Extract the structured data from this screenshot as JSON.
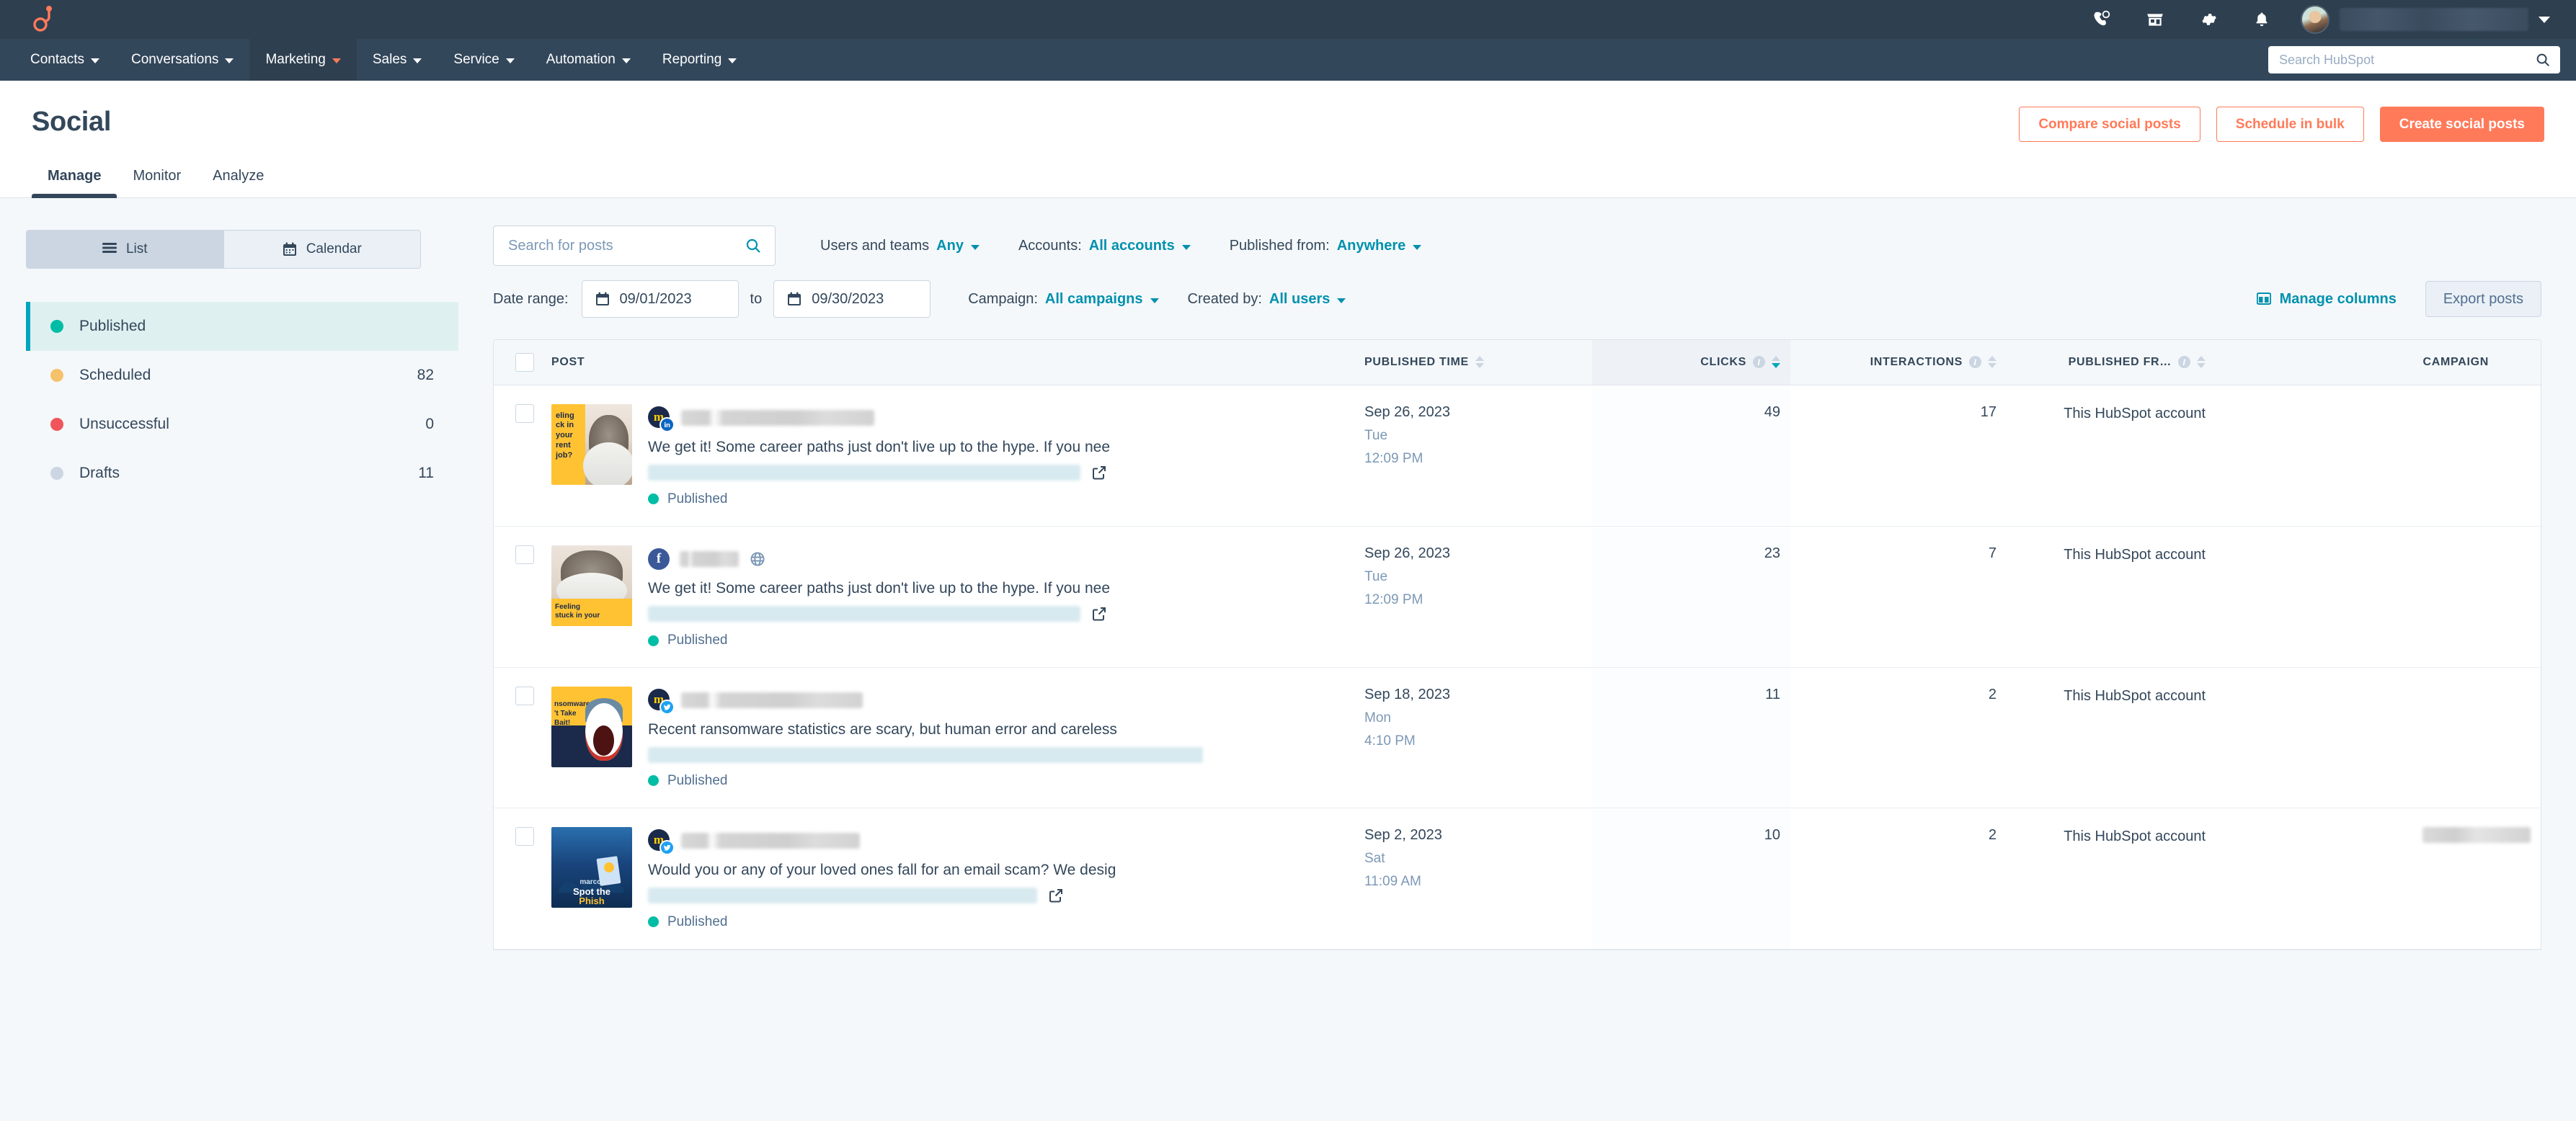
{
  "topbar": {
    "logo_name": "hubspot-sprocket-logo",
    "icons": [
      "phone-icon",
      "marketplace-icon",
      "gear-icon",
      "bell-icon"
    ],
    "account_name_redacted": "",
    "chevron": "chevron-down-icon"
  },
  "mainnav": {
    "items": [
      {
        "label": "Contacts",
        "active": false
      },
      {
        "label": "Conversations",
        "active": false
      },
      {
        "label": "Marketing",
        "active": true
      },
      {
        "label": "Sales",
        "active": false
      },
      {
        "label": "Service",
        "active": false
      },
      {
        "label": "Automation",
        "active": false
      },
      {
        "label": "Reporting",
        "active": false
      }
    ],
    "search_placeholder": "Search HubSpot"
  },
  "page": {
    "title": "Social",
    "actions": {
      "compare": "Compare social posts",
      "schedule": "Schedule in bulk",
      "create": "Create social posts"
    },
    "tabs": [
      {
        "label": "Manage",
        "active": true
      },
      {
        "label": "Monitor",
        "active": false
      },
      {
        "label": "Analyze",
        "active": false
      }
    ]
  },
  "sidebar": {
    "view_toggle": [
      {
        "label": "List",
        "icon": "list-icon",
        "active": true
      },
      {
        "label": "Calendar",
        "icon": "calendar-icon",
        "active": false
      }
    ],
    "statuses": [
      {
        "label": "Published",
        "count": "",
        "color": "#00bda5",
        "active": true
      },
      {
        "label": "Scheduled",
        "count": "82",
        "color": "#f5c26b",
        "active": false
      },
      {
        "label": "Unsuccessful",
        "count": "0",
        "color": "#f2545b",
        "active": false
      },
      {
        "label": "Drafts",
        "count": "11",
        "color": "#cbd6e2",
        "active": false
      }
    ]
  },
  "filters": {
    "search_placeholder": "Search for posts",
    "users_and_teams": {
      "label": "Users and teams",
      "value": "Any"
    },
    "accounts": {
      "label": "Accounts:",
      "value": "All accounts"
    },
    "published_from": {
      "label": "Published from:",
      "value": "Anywhere"
    },
    "date_range": {
      "label": "Date range:",
      "from": "09/01/2023",
      "to_word": "to",
      "to": "09/30/2023"
    },
    "campaign": {
      "label": "Campaign:",
      "value": "All campaigns"
    },
    "created_by": {
      "label": "Created by:",
      "value": "All users"
    },
    "manage_columns": "Manage columns",
    "export_posts": "Export posts"
  },
  "table": {
    "columns": [
      {
        "key": "post",
        "label": "POST",
        "info": false,
        "sort": "none"
      },
      {
        "key": "published_time",
        "label": "PUBLISHED TIME",
        "info": false,
        "sort": "none"
      },
      {
        "key": "clicks",
        "label": "CLICKS",
        "info": true,
        "sort": "desc"
      },
      {
        "key": "interactions",
        "label": "INTERACTIONS",
        "info": true,
        "sort": "none"
      },
      {
        "key": "published_from",
        "label": "PUBLISHED FR…",
        "info": true,
        "sort": "none"
      },
      {
        "key": "campaign",
        "label": "CAMPAIGN",
        "info": false,
        "sort": "none"
      }
    ],
    "rows": [
      {
        "network": "linkedin",
        "thumb": "cat-cone-yellow",
        "text": "We get it! Some career paths just don't live up to the hype. If you nee",
        "status": "Published",
        "published_date": "Sep 26, 2023",
        "published_day": "Tue",
        "published_time": "12:09 PM",
        "clicks": "49",
        "interactions": "17",
        "published_from": "This HubSpot account",
        "campaign": "",
        "campaign_redacted": false
      },
      {
        "network": "facebook",
        "thumb": "cat-cone-white",
        "text": "We get it! Some career paths just don't live up to the hype. If you nee",
        "status": "Published",
        "published_date": "Sep 26, 2023",
        "published_day": "Tue",
        "published_time": "12:09 PM",
        "clicks": "23",
        "interactions": "7",
        "published_from": "This HubSpot account",
        "campaign": "",
        "campaign_redacted": false
      },
      {
        "network": "twitter",
        "thumb": "shark-ransomware",
        "text": "Recent ransomware statistics are scary, but human error and careless",
        "status": "Published",
        "published_date": "Sep 18, 2023",
        "published_day": "Mon",
        "published_time": "4:10 PM",
        "clicks": "11",
        "interactions": "2",
        "published_from": "This HubSpot account",
        "campaign": "",
        "campaign_redacted": false
      },
      {
        "network": "twitter",
        "thumb": "spot-the-phish",
        "text": "Would you or any of your loved ones fall for an email scam? We desig",
        "status": "Published",
        "published_date": "Sep 2, 2023",
        "published_day": "Sat",
        "published_time": "11:09 AM",
        "clicks": "10",
        "interactions": "2",
        "published_from": "This HubSpot account",
        "campaign": "",
        "campaign_redacted": true
      }
    ],
    "thumb_text": {
      "cat_cone_yellow": "eling\nck in your\nrent job?",
      "cat_cone_white": "Feeling\nstuck in your",
      "shark": "nsomware:\n't Take\nBait!",
      "phish_logo": "marco)",
      "phish_line1": "Spot the",
      "phish_line2": "Phish"
    }
  },
  "colors": {
    "brand_orange": "#ff7a59",
    "nav_dark": "#33475b",
    "nav_darker": "#2e3f50",
    "teal": "#00a4bd",
    "link_teal": "#0091ae",
    "published_green": "#00bda5",
    "scheduled_amber": "#f5c26b",
    "unsuccessful_red": "#f2545b",
    "draft_grey": "#cbd6e2",
    "page_bg": "#f5f8fa"
  }
}
